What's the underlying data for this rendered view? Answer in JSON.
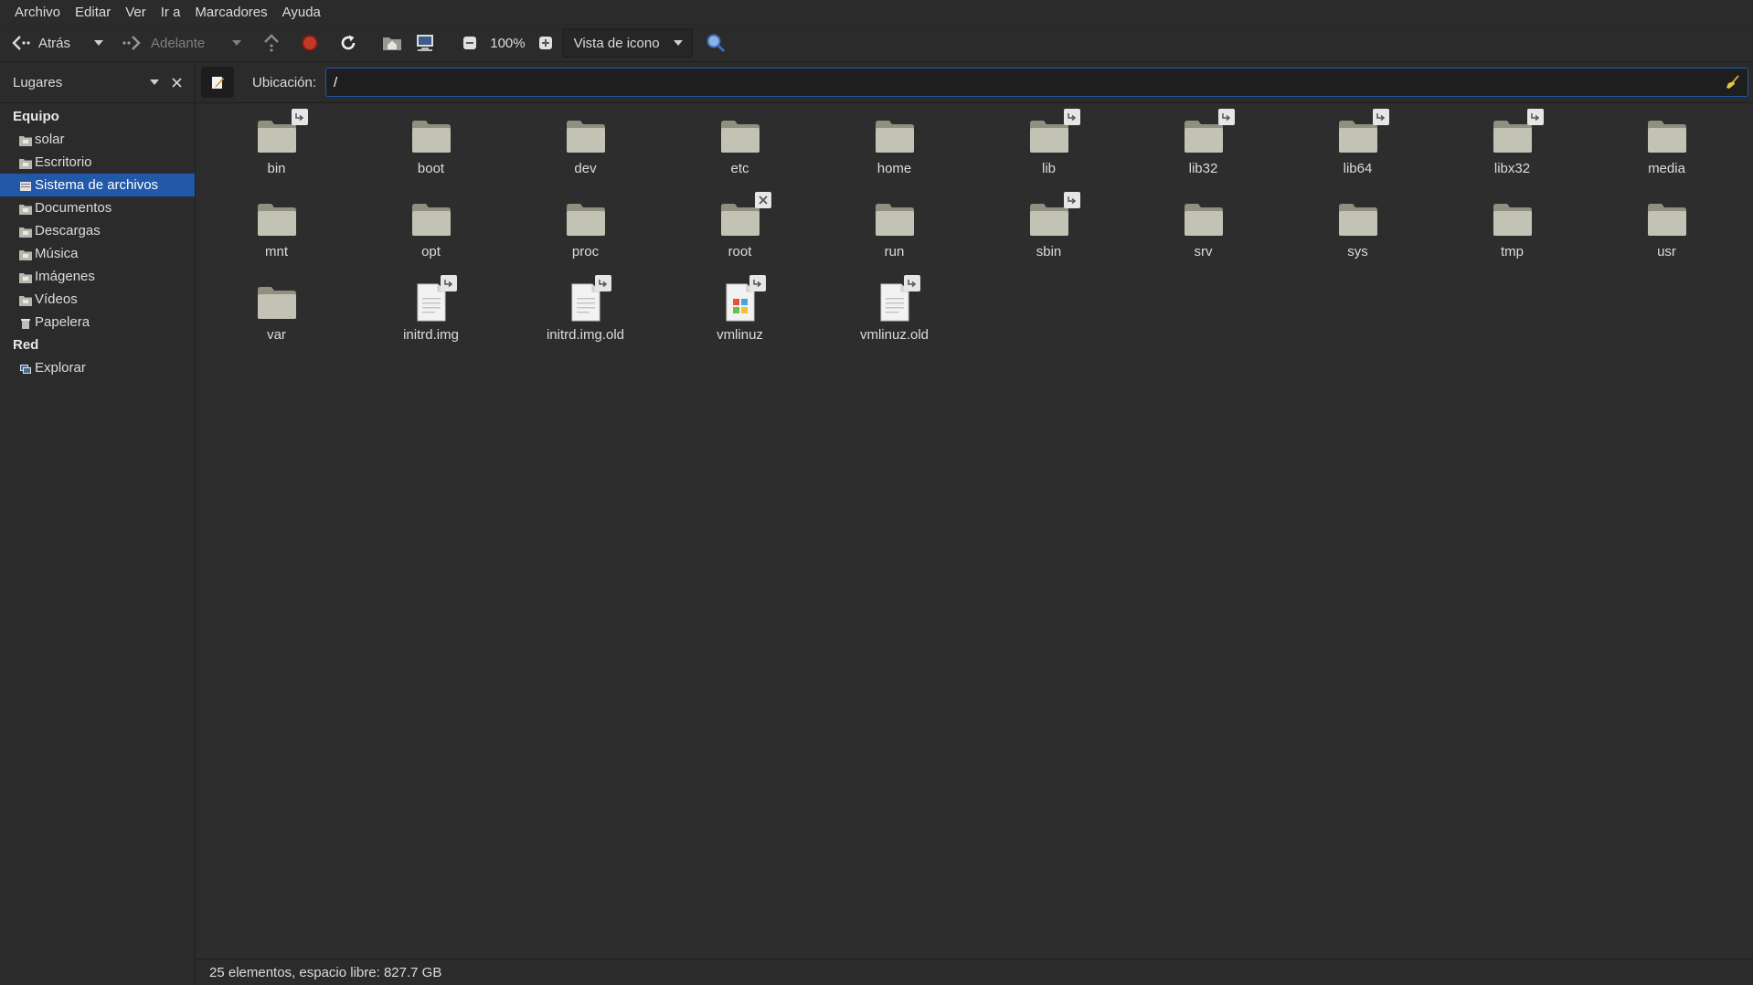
{
  "menu": [
    "Archivo",
    "Editar",
    "Ver",
    "Ir a",
    "Marcadores",
    "Ayuda"
  ],
  "toolbar": {
    "back_label": "Atrás",
    "forward_label": "Adelante",
    "zoom": "100%",
    "view_mode": "Vista de icono"
  },
  "sidebar": {
    "header": "Lugares",
    "sections": [
      {
        "title": "Equipo",
        "items": [
          {
            "label": "solar",
            "icon": "home-folder-icon"
          },
          {
            "label": "Escritorio",
            "icon": "desktop-folder-icon"
          },
          {
            "label": "Sistema de archivos",
            "icon": "filesystem-icon",
            "selected": true
          },
          {
            "label": "Documentos",
            "icon": "documents-folder-icon"
          },
          {
            "label": "Descargas",
            "icon": "downloads-folder-icon"
          },
          {
            "label": "Música",
            "icon": "music-folder-icon"
          },
          {
            "label": "Imágenes",
            "icon": "pictures-folder-icon"
          },
          {
            "label": "Vídeos",
            "icon": "videos-folder-icon"
          },
          {
            "label": "Papelera",
            "icon": "trash-icon"
          }
        ]
      },
      {
        "title": "Red",
        "items": [
          {
            "label": "Explorar",
            "icon": "network-icon"
          }
        ]
      }
    ]
  },
  "location": {
    "label": "Ubicación:",
    "value": "/"
  },
  "files": [
    {
      "name": "bin",
      "type": "folder",
      "emblem": "symlink"
    },
    {
      "name": "boot",
      "type": "folder"
    },
    {
      "name": "dev",
      "type": "folder"
    },
    {
      "name": "etc",
      "type": "folder"
    },
    {
      "name": "home",
      "type": "folder"
    },
    {
      "name": "lib",
      "type": "folder",
      "emblem": "symlink"
    },
    {
      "name": "lib32",
      "type": "folder",
      "emblem": "symlink"
    },
    {
      "name": "lib64",
      "type": "folder",
      "emblem": "symlink"
    },
    {
      "name": "libx32",
      "type": "folder",
      "emblem": "symlink"
    },
    {
      "name": "media",
      "type": "folder"
    },
    {
      "name": "mnt",
      "type": "folder"
    },
    {
      "name": "opt",
      "type": "folder"
    },
    {
      "name": "proc",
      "type": "folder"
    },
    {
      "name": "root",
      "type": "folder",
      "emblem": "noaccess"
    },
    {
      "name": "run",
      "type": "folder"
    },
    {
      "name": "sbin",
      "type": "folder",
      "emblem": "symlink"
    },
    {
      "name": "srv",
      "type": "folder"
    },
    {
      "name": "sys",
      "type": "folder"
    },
    {
      "name": "tmp",
      "type": "folder"
    },
    {
      "name": "usr",
      "type": "folder"
    },
    {
      "name": "var",
      "type": "folder"
    },
    {
      "name": "initrd.img",
      "type": "file",
      "emblem": "symlink"
    },
    {
      "name": "initrd.img.old",
      "type": "file",
      "emblem": "symlink"
    },
    {
      "name": "vmlinuz",
      "type": "executable",
      "emblem": "symlink"
    },
    {
      "name": "vmlinuz.old",
      "type": "file",
      "emblem": "symlink"
    }
  ],
  "status": "25 elementos, espacio libre: 827.7 GB",
  "colors": {
    "selection": "#2158a8",
    "folder": "#c2c3b4",
    "stop": "#c0392b"
  }
}
